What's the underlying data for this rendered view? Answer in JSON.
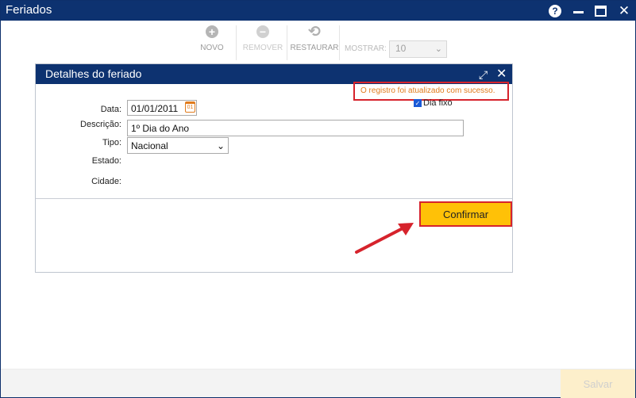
{
  "window": {
    "title": "Feriados",
    "help_icon": "question-circle-icon",
    "help_glyph": "?"
  },
  "toolbar": {
    "new_label": "NOVO",
    "remove_label": "REMOVER",
    "restore_label": "RESTAURAR",
    "show_label": "MOSTRAR:",
    "show_value": "10",
    "new_glyph": "+",
    "remove_glyph": "−",
    "restore_glyph": "⟲"
  },
  "dialog": {
    "title": "Detalhes do feriado",
    "success_message": "O registro foi atualizado com sucesso.",
    "fields": {
      "date_label": "Data:",
      "date_value": "01/01/2011",
      "description_label": "Descrição:",
      "description_value": "1º Dia do Ano",
      "type_label": "Tipo:",
      "type_value": "Nacional",
      "state_label": "Estado:",
      "city_label": "Cidade:",
      "fixed_day_label": "Dia fixo",
      "fixed_day_checked": true
    },
    "confirm_label": "Confirmar"
  },
  "footer": {
    "save_label": "Salvar"
  },
  "colors": {
    "header": "#0d3270",
    "confirm": "#ffc107",
    "highlight": "#d6232c",
    "success_text": "#e07b1d"
  }
}
